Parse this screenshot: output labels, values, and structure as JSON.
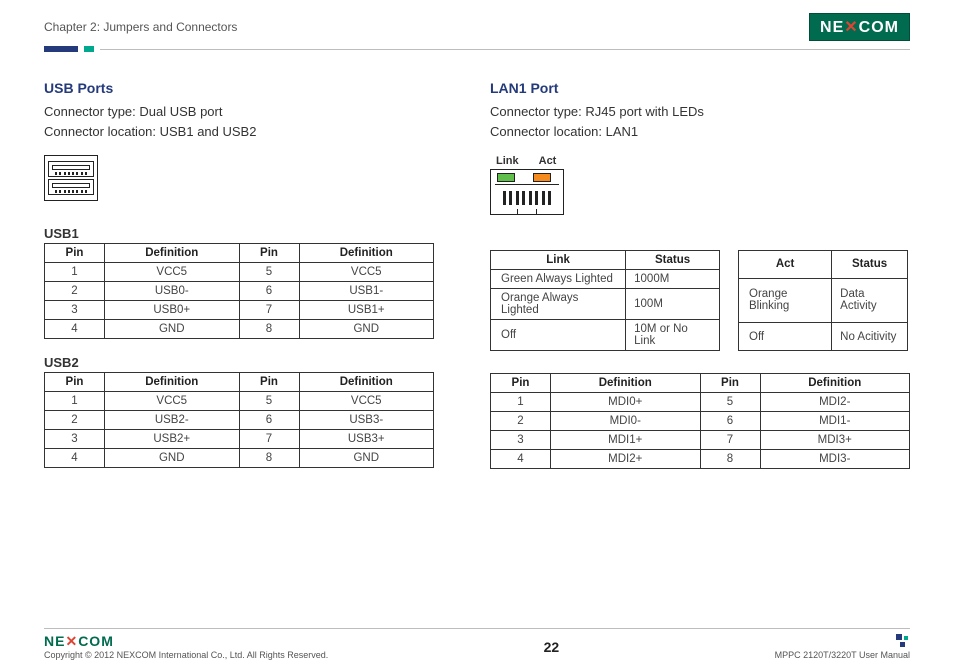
{
  "header": {
    "chapter": "Chapter 2: Jumpers and Connectors",
    "logo": "NEXCOM"
  },
  "usb": {
    "title": "USB Ports",
    "type_line": "Connector type: Dual USB port",
    "loc_line": "Connector location: USB1 and USB2",
    "usb1_title": "USB1",
    "usb2_title": "USB2",
    "headers": {
      "pin": "Pin",
      "def": "Definition"
    },
    "usb1_rows": [
      {
        "p1": "1",
        "d1": "VCC5",
        "p2": "5",
        "d2": "VCC5"
      },
      {
        "p1": "2",
        "d1": "USB0-",
        "p2": "6",
        "d2": "USB1-"
      },
      {
        "p1": "3",
        "d1": "USB0+",
        "p2": "7",
        "d2": "USB1+"
      },
      {
        "p1": "4",
        "d1": "GND",
        "p2": "8",
        "d2": "GND"
      }
    ],
    "usb2_rows": [
      {
        "p1": "1",
        "d1": "VCC5",
        "p2": "5",
        "d2": "VCC5"
      },
      {
        "p1": "2",
        "d1": "USB2-",
        "p2": "6",
        "d2": "USB3-"
      },
      {
        "p1": "3",
        "d1": "USB2+",
        "p2": "7",
        "d2": "USB3+"
      },
      {
        "p1": "4",
        "d1": "GND",
        "p2": "8",
        "d2": "GND"
      }
    ]
  },
  "lan": {
    "title": "LAN1 Port",
    "type_line": "Connector type: RJ45 port with LEDs",
    "loc_line": "Connector location: LAN1",
    "link_label": "Link",
    "act_label": "Act",
    "status_label": "Status",
    "link_rows": [
      {
        "k": "Green Always Lighted",
        "v": "1000M"
      },
      {
        "k": "Orange Always Lighted",
        "v": "100M"
      },
      {
        "k": "Off",
        "v": "10M or No Link"
      }
    ],
    "act_rows": [
      {
        "k": "Orange Blinking",
        "v": "Data Activity"
      },
      {
        "k": "Off",
        "v": "No Acitivity"
      }
    ],
    "headers": {
      "pin": "Pin",
      "def": "Definition"
    },
    "pin_rows": [
      {
        "p1": "1",
        "d1": "MDI0+",
        "p2": "5",
        "d2": "MDI2-"
      },
      {
        "p1": "2",
        "d1": "MDI0-",
        "p2": "6",
        "d2": "MDI1-"
      },
      {
        "p1": "3",
        "d1": "MDI1+",
        "p2": "7",
        "d2": "MDI3+"
      },
      {
        "p1": "4",
        "d1": "MDI2+",
        "p2": "8",
        "d2": "MDI3-"
      }
    ]
  },
  "footer": {
    "logo": "NEXCOM",
    "copyright": "Copyright © 2012 NEXCOM International Co., Ltd. All Rights Reserved.",
    "page": "22",
    "manual": "MPPC 2120T/3220T User Manual"
  }
}
